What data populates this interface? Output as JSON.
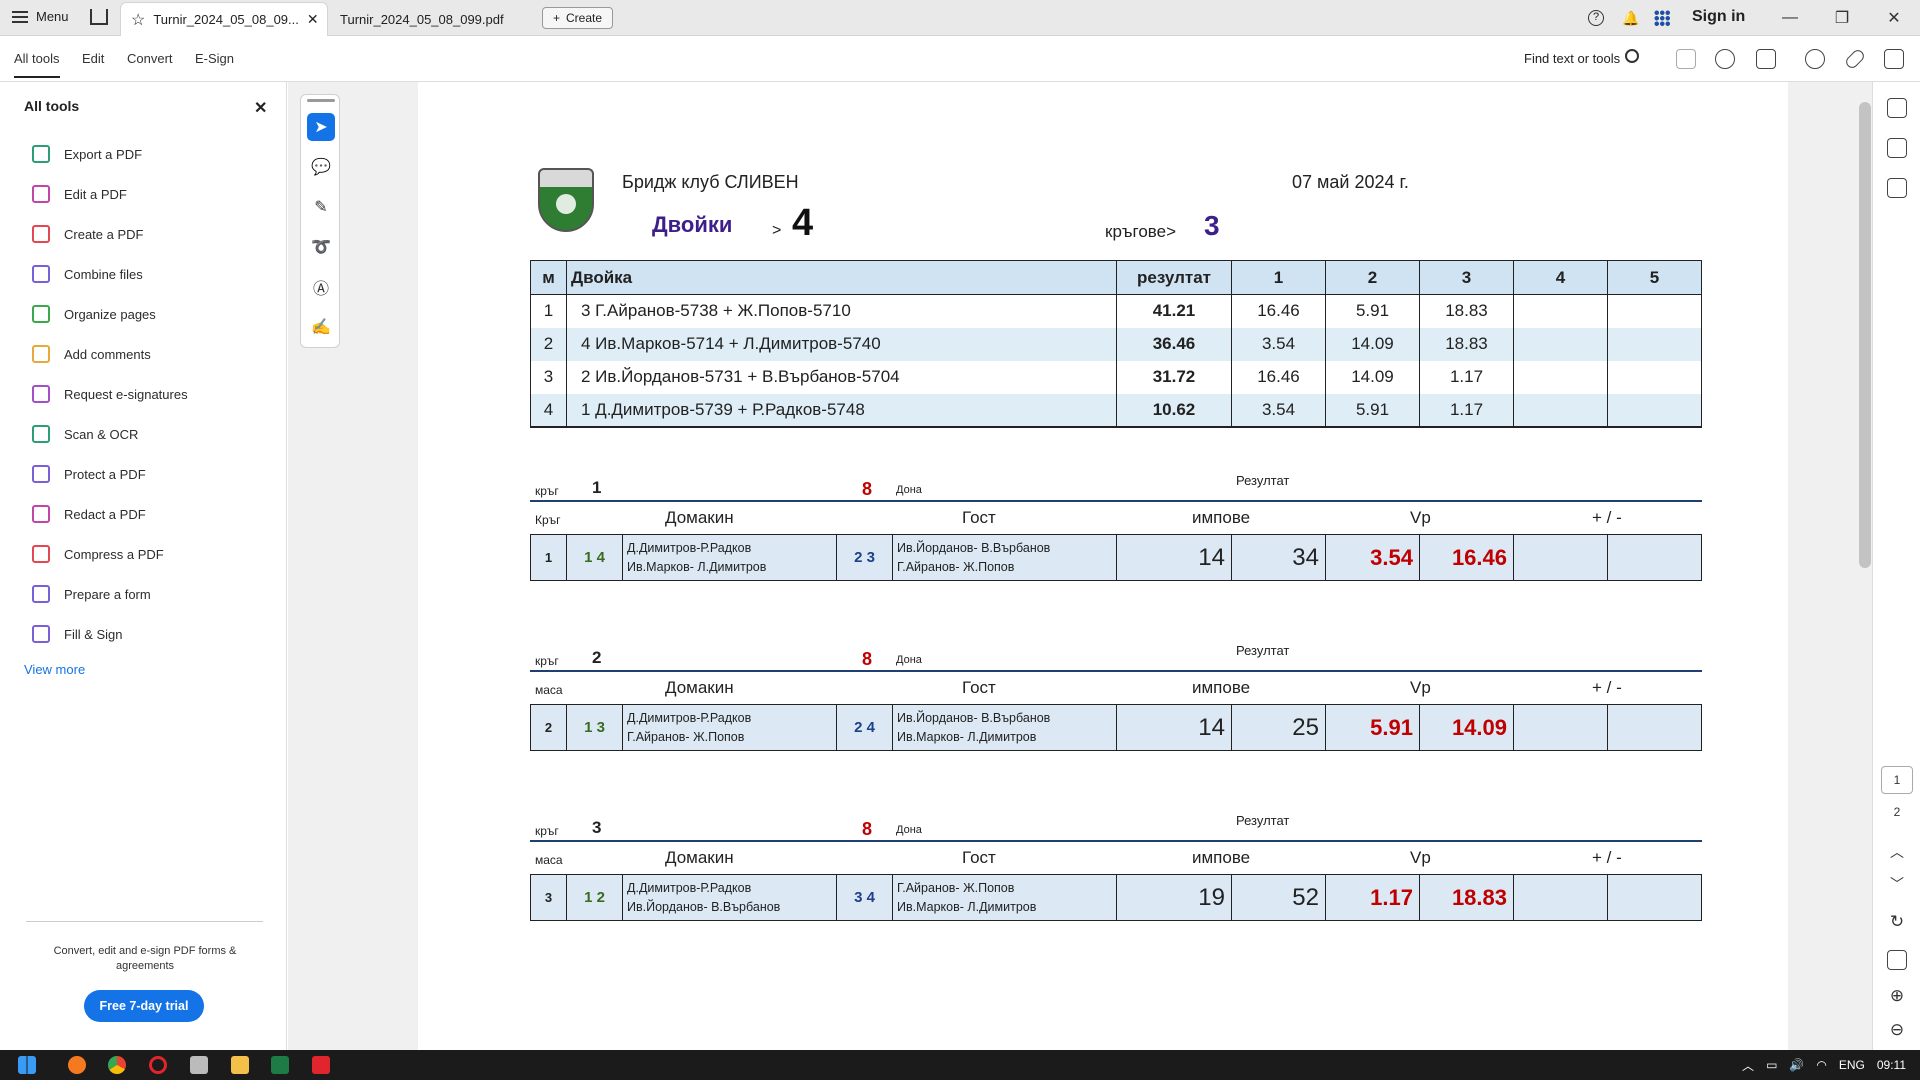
{
  "titlebar": {
    "menu_label": "Menu",
    "tab1": "Turnir_2024_05_08_09...",
    "tab2": "Turnir_2024_05_08_099.pdf",
    "create_label": "Create",
    "signin": "Sign in"
  },
  "toolbar": {
    "tabs": [
      "All tools",
      "Edit",
      "Convert",
      "E-Sign"
    ],
    "find": "Find text or tools"
  },
  "leftpanel": {
    "title": "All tools",
    "tools": [
      "Export a PDF",
      "Edit a PDF",
      "Create a PDF",
      "Combine files",
      "Organize pages",
      "Add comments",
      "Request e-signatures",
      "Scan & OCR",
      "Protect a PDF",
      "Redact a PDF",
      "Compress a PDF",
      "Prepare a form",
      "Fill & Sign"
    ],
    "tool_colors": [
      "#2d9d78",
      "#c046a8",
      "#e34850",
      "#7a5fd9",
      "#3da74e",
      "#e8a93c",
      "#a24fc8",
      "#2d9d78",
      "#7a5fd9",
      "#c046a8",
      "#e34850",
      "#7a5fd9",
      "#7a5fd9"
    ],
    "view_more": "View more",
    "promo": "Convert, edit and e-sign PDF forms & agreements",
    "trial": "Free 7-day trial"
  },
  "pages": {
    "p1": "1",
    "p2": "2"
  },
  "doc": {
    "club": "Бридж клуб СЛИВЕН",
    "date": "07 май 2024 г.",
    "dvoiki": "Двойки",
    "gt": ">",
    "pairs_count": "4",
    "krugove_label": "кръгове>",
    "krugove_count": "3",
    "standings": {
      "headers": [
        "м",
        "Двойка",
        "резултат",
        "1",
        "2",
        "3",
        "4",
        "5"
      ],
      "rows": [
        {
          "place": "1",
          "pair": "3  Г.Айранов-5738 +  Ж.Попов-5710",
          "result": "41.21",
          "r1": "16.46",
          "r2": "5.91",
          "r3": "18.83"
        },
        {
          "place": "2",
          "pair": "4  Ив.Марков-5714 +  Л.Димитров-5740",
          "result": "36.46",
          "r1": "3.54",
          "r2": "14.09",
          "r3": "18.83"
        },
        {
          "place": "3",
          "pair": "2  Ив.Йорданов-5731 +  В.Върбанов-5704",
          "result": "31.72",
          "r1": "16.46",
          "r2": "14.09",
          "r3": "1.17"
        },
        {
          "place": "4",
          "pair": "1  Д.Димитров-5739 + Р.Радков-5748",
          "result": "10.62",
          "r1": "3.54",
          "r2": "5.91",
          "r3": "1.17"
        }
      ]
    },
    "rounds": [
      {
        "krug": "кръг",
        "num": "1",
        "boards": "8",
        "dona": "Дона",
        "rezultat": "Резултат",
        "col0": "Кръг",
        "domakin": "Домакин",
        "gost": "Гост",
        "impove": "импове",
        "vp": "Vp",
        "pm": "+ / -",
        "row": {
          "idx": "1",
          "home_nums": "1 4",
          "home_names1": "Д.Димитров-Р.Радков",
          "home_names2": "Ив.Марков- Л.Димитров",
          "guest_nums": "2 3",
          "guest_names1": " Ив.Йорданов- В.Върбанов",
          "guest_names2": "Г.Айранов- Ж.Попов",
          "imp1": "14",
          "imp2": "34",
          "vp1": "3.54",
          "vp2": "16.46"
        }
      },
      {
        "krug": "кръг",
        "num": "2",
        "boards": "8",
        "dona": "Дона",
        "rezultat": "Резултат",
        "col0": "маса",
        "domakin": "Домакин",
        "gost": "Гост",
        "impove": "импове",
        "vp": "Vp",
        "pm": "+ / -",
        "row": {
          "idx": "2",
          "home_nums": "1 3",
          "home_names1": "Д.Димитров-Р.Радков",
          "home_names2": "Г.Айранов- Ж.Попов",
          "guest_nums": "2 4",
          "guest_names1": " Ив.Йорданов- В.Върбанов",
          "guest_names2": "Ив.Марков- Л.Димитров",
          "imp1": "14",
          "imp2": "25",
          "vp1": "5.91",
          "vp2": "14.09"
        }
      },
      {
        "krug": "кръг",
        "num": "3",
        "boards": "8",
        "dona": "Дона",
        "rezultat": "Резултат",
        "col0": "маса",
        "domakin": "Домакин",
        "gost": "Гост",
        "impove": "импове",
        "vp": "Vp",
        "pm": "+ / -",
        "row": {
          "idx": "3",
          "home_nums": "1 2",
          "home_names1": "Д.Димитров-Р.Радков",
          "home_names2": "Ив.Йорданов- В.Върбанов",
          "guest_nums": "3 4",
          "guest_names1": " Г.Айранов- Ж.Попов",
          "guest_names2": "Ив.Марков- Л.Димитров",
          "imp1": "19",
          "imp2": "52",
          "vp1": "1.17",
          "vp2": "18.83"
        }
      }
    ]
  },
  "taskbar": {
    "lang": "ENG",
    "time": "09:11"
  }
}
